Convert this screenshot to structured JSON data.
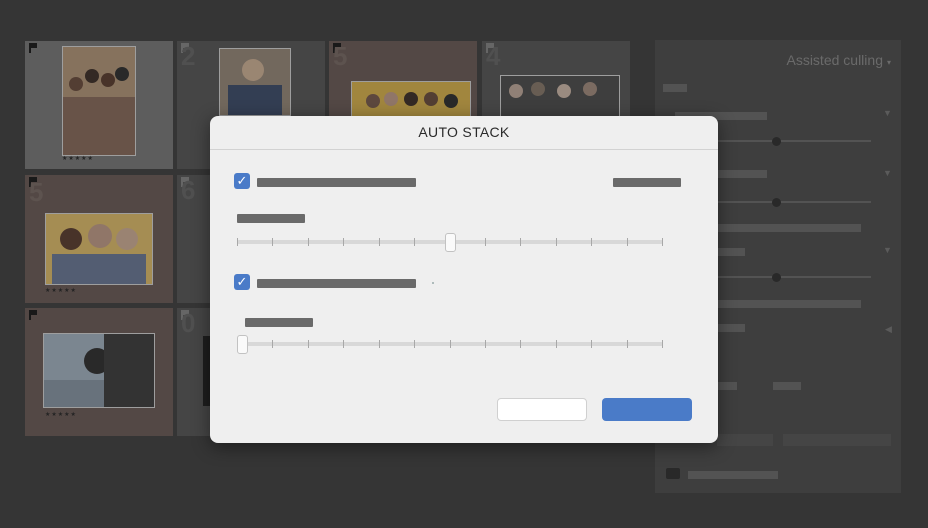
{
  "side_panel": {
    "title": "Assisted culling",
    "caret": "▾"
  },
  "grid": {
    "numbers": [
      "2",
      "4",
      "5",
      "6",
      "8",
      "0"
    ],
    "stars": "★★★★★"
  },
  "dialog": {
    "title": "AUTO STACK",
    "check_mark": "✓",
    "slider1_value": 0.5,
    "slider2_value": 0.0,
    "cancel_label": "",
    "ok_label": ""
  },
  "colors": {
    "accent": "#4a7bc8",
    "dialog_bg": "#efefef",
    "app_bg": "#3c3c3c"
  }
}
